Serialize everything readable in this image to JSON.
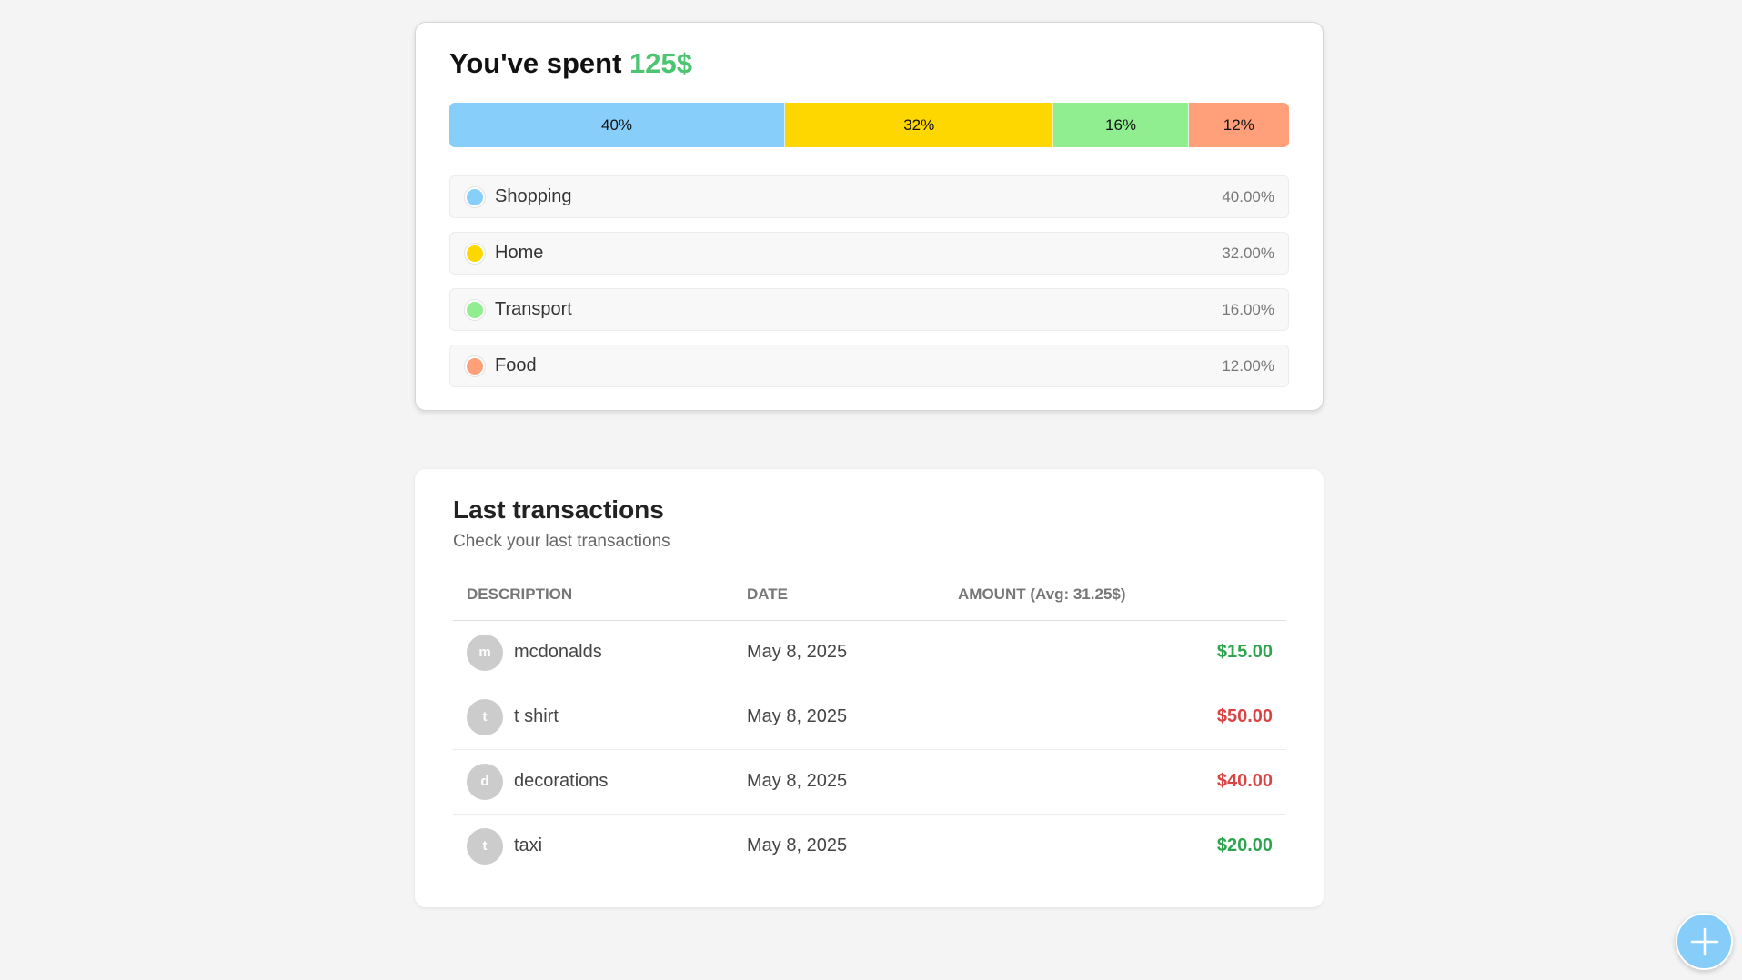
{
  "spent": {
    "title_prefix": "You've spent ",
    "amount": "125$",
    "bar": [
      {
        "label": "40%",
        "value": 40,
        "color": "#87cefa"
      },
      {
        "label": "32%",
        "value": 32,
        "color": "#ffd700"
      },
      {
        "label": "16%",
        "value": 16,
        "color": "#90ee90"
      },
      {
        "label": "12%",
        "value": 12,
        "color": "#ffa07a"
      }
    ],
    "categories": [
      {
        "name": "Shopping",
        "percent": "40.00%",
        "color": "#87cefa"
      },
      {
        "name": "Home",
        "percent": "32.00%",
        "color": "#ffd700"
      },
      {
        "name": "Transport",
        "percent": "16.00%",
        "color": "#90ee90"
      },
      {
        "name": "Food",
        "percent": "12.00%",
        "color": "#ffa07a"
      }
    ]
  },
  "transactions": {
    "title": "Last transactions",
    "subtitle": "Check your last transactions",
    "headers": {
      "description": "DESCRIPTION",
      "date": "DATE",
      "amount": "AMOUNT (Avg: 31.25$)"
    },
    "rows": [
      {
        "initial": "m",
        "description": "mcdonalds",
        "date": "May 8, 2025",
        "amount": "$15.00",
        "status": "green"
      },
      {
        "initial": "t",
        "description": "t shirt",
        "date": "May 8, 2025",
        "amount": "$50.00",
        "status": "red"
      },
      {
        "initial": "d",
        "description": "decorations",
        "date": "May 8, 2025",
        "amount": "$40.00",
        "status": "red"
      },
      {
        "initial": "t",
        "description": "taxi",
        "date": "May 8, 2025",
        "amount": "$20.00",
        "status": "green"
      }
    ]
  },
  "fab": {
    "icon": "plus-icon"
  }
}
